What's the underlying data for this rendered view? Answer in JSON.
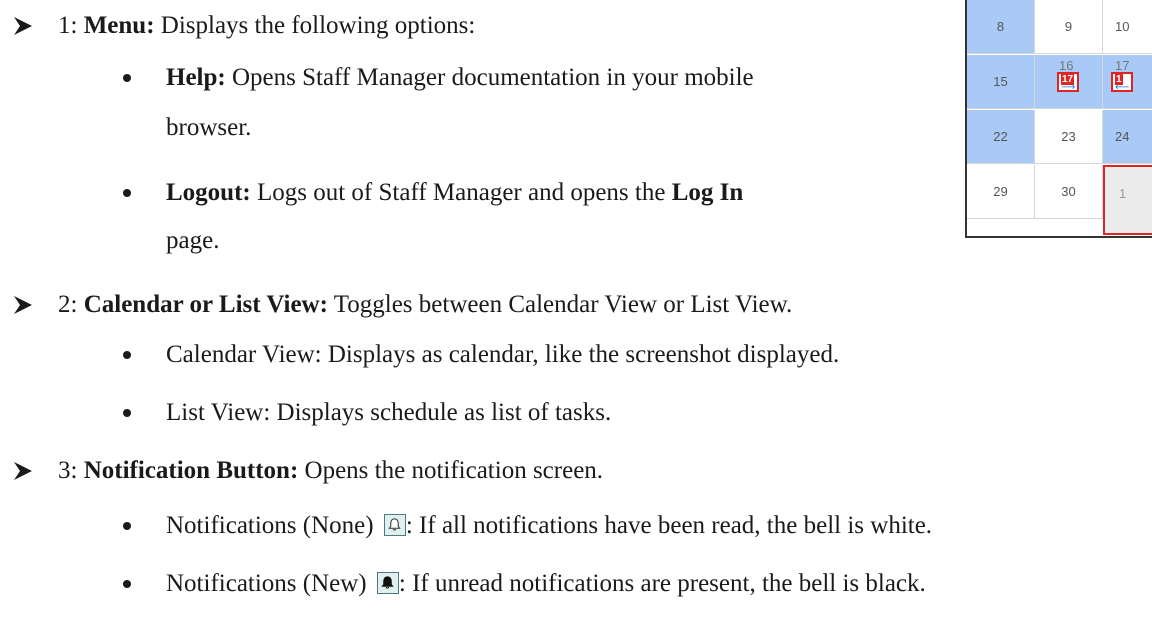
{
  "items": [
    {
      "num": "1:",
      "term": "Menu",
      "desc": "Displays the following options:",
      "subs": [
        {
          "term": "Help",
          "desc_1": "Opens Staff Manager documentation in your mobile",
          "desc_2": "browser."
        },
        {
          "term": "Logout",
          "desc_1a": "Logs out of Staff Manager and opens the ",
          "desc_1b": "Log In",
          "desc_2": "page."
        }
      ]
    },
    {
      "num": "2:",
      "term": "Calendar or List View",
      "desc": "Toggles between Calendar View or List View.",
      "subs": [
        {
          "text": "Calendar View: Displays as calendar, like the screenshot displayed."
        },
        {
          "text": "List View: Displays schedule as list of tasks."
        }
      ]
    },
    {
      "num": "3:",
      "term": "Notification Button",
      "desc": "Opens the notification screen.",
      "subs": [
        {
          "label": "Notifications (None)",
          "desc": ": If all notifications have been read, the bell is white."
        },
        {
          "label": "Notifications (New)",
          "desc": ": If unread notifications are present, the bell is black."
        }
      ]
    }
  ],
  "calendar": {
    "rows": [
      [
        "8",
        "9",
        "10"
      ],
      [
        "15",
        "16",
        "17"
      ],
      [
        "22",
        "23",
        "24"
      ],
      [
        "29",
        "30",
        "1"
      ]
    ],
    "badge_left": "17",
    "badge_right": "1"
  },
  "colors": {
    "highlight_blue": "#a9c9f6",
    "today_border": "#e02424",
    "bell_box": "#dff0ef"
  }
}
